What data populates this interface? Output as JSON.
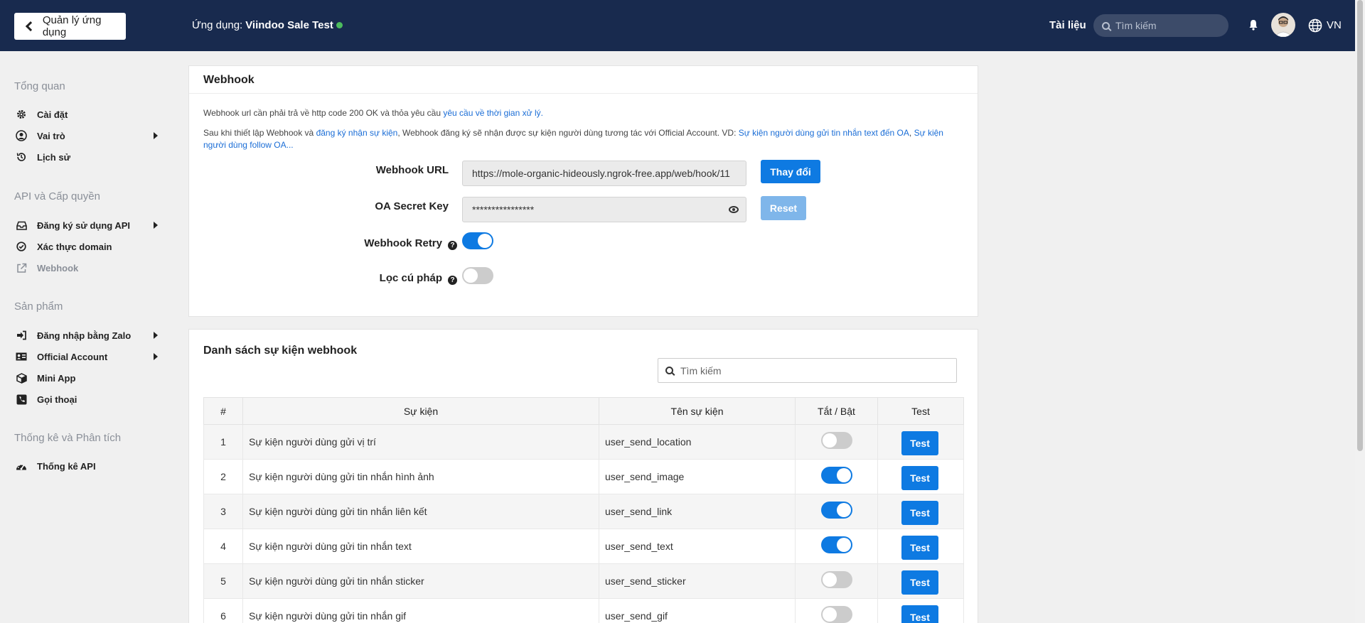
{
  "topbar": {
    "back_label": "Quản lý ứng dụng",
    "app_prefix": "Ứng dụng:",
    "app_name": "Viindoo Sale Test",
    "docs": "Tài liệu",
    "search_placeholder": "Tìm kiếm",
    "lang": "VN"
  },
  "sidebar": {
    "sections": [
      {
        "title": "Tổng quan",
        "items": [
          {
            "label": "Cài đặt",
            "icon": "gear-icon"
          },
          {
            "label": "Vai trò",
            "icon": "user-circle-icon",
            "submenu": true
          },
          {
            "label": "Lịch sử",
            "icon": "history-icon"
          }
        ]
      },
      {
        "title": "API và Cấp quyền",
        "items": [
          {
            "label": "Đăng ký sử dụng API",
            "icon": "inbox-icon",
            "submenu": true
          },
          {
            "label": "Xác thực domain",
            "icon": "check-circle-icon"
          },
          {
            "label": "Webhook",
            "icon": "external-link-icon",
            "active": true
          }
        ]
      },
      {
        "title": "Sản phẩm",
        "items": [
          {
            "label": "Đăng nhập bằng Zalo",
            "icon": "sign-in-icon",
            "submenu": true
          },
          {
            "label": "Official Account",
            "icon": "id-card-icon",
            "submenu": true
          },
          {
            "label": "Mini App",
            "icon": "cube-icon"
          },
          {
            "label": "Gọi thoại",
            "icon": "phone-icon"
          }
        ]
      },
      {
        "title": "Thống kê và Phân tích",
        "items": [
          {
            "label": "Thống kê API",
            "icon": "dashboard-icon"
          }
        ]
      }
    ]
  },
  "webhook": {
    "title": "Webhook",
    "note1_text": "Webhook url cần phải trả về http code 200 OK và thỏa yêu cầu",
    "note1_link": "yêu cầu về thời gian xử lý.",
    "note2_text1": "Sau khi thiết lập Webhook và",
    "note2_link1": "đăng ký nhận sự kiện",
    "note2_text2": ", Webhook đăng ký sẽ nhận được sự kiện người dùng tương tác với Official Account. VD:",
    "note2_link2": "Sự kiện người dùng gửi tin nhắn text đến OA",
    "note2_sep": ",",
    "note2_link3": "Sự kiện người dùng follow OA...",
    "url_label": "Webhook URL",
    "url_value": "https://mole-organic-hideously.ngrok-free.app/web/hook/11",
    "change_label": "Thay đổi",
    "secret_label": "OA Secret Key",
    "secret_value": "****************",
    "reset_label": "Reset",
    "retry_label": "Webhook Retry",
    "retry_on": true,
    "syntax_label": "Lọc cú pháp",
    "syntax_on": false,
    "help_glyph": "?"
  },
  "events": {
    "title": "Danh sách sự kiện webhook",
    "search_placeholder": "Tìm kiếm",
    "columns": [
      "#",
      "Sự kiện",
      "Tên sự kiện",
      "Tắt / Bật",
      "Test"
    ],
    "test_label": "Test",
    "rows": [
      {
        "num": "1",
        "event": "Sự kiện người dùng gửi vị trí",
        "name": "user_send_location",
        "enabled": false
      },
      {
        "num": "2",
        "event": "Sự kiện người dùng gửi tin nhắn hình ảnh",
        "name": "user_send_image",
        "enabled": true
      },
      {
        "num": "3",
        "event": "Sự kiện người dùng gửi tin nhắn liên kết",
        "name": "user_send_link",
        "enabled": true
      },
      {
        "num": "4",
        "event": "Sự kiện người dùng gửi tin nhắn text",
        "name": "user_send_text",
        "enabled": true
      },
      {
        "num": "5",
        "event": "Sự kiện người dùng gửi tin nhắn sticker",
        "name": "user_send_sticker",
        "enabled": false
      },
      {
        "num": "6",
        "event": "Sự kiện người dùng gửi tin nhắn gif",
        "name": "user_send_gif",
        "enabled": false
      }
    ]
  },
  "colors": {
    "topbar": "#182a4e",
    "primary": "#0e7ae2",
    "link": "#1a6dd6",
    "online": "#4cbb5e"
  }
}
